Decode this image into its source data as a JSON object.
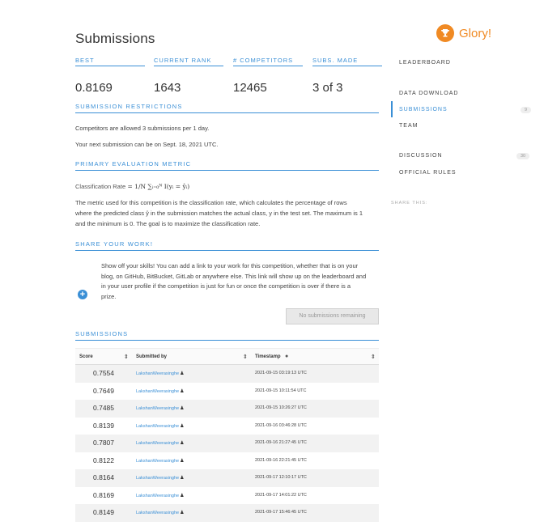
{
  "page": {
    "title": "Submissions"
  },
  "stats": [
    {
      "label": "BEST",
      "value": "0.8169"
    },
    {
      "label": "CURRENT RANK",
      "value": "1643"
    },
    {
      "label": "# COMPETITORS",
      "value": "12465"
    },
    {
      "label": "SUBS. MADE",
      "value": "3 of 3"
    }
  ],
  "restrictions": {
    "heading": "SUBMISSION RESTRICTIONS",
    "line1": "Competitors are allowed 3 submissions per 1 day.",
    "line2": "Your next submission can be on Sept. 18, 2021 UTC."
  },
  "metric": {
    "heading": "PRIMARY EVALUATION METRIC",
    "formula_label": "Classification Rate",
    "formula": "= 1/N ∑ᵢ₌₀ᴺ I(yᵢ = ŷᵢ)",
    "description_1": "The metric used for this competition is the classification rate, which calculates the percentage of rows",
    "description_2": "where the predicted class ŷ in the submission matches the actual class, y in the test set. The maximum is 1",
    "description_3": "and the minimum is 0. The goal is to maximize the classification rate."
  },
  "share": {
    "heading": "SHARE YOUR WORK!",
    "icon": "plus-circle-icon",
    "text_1": "Show off your skills! You can add a link to your work for this competition, whether that is on your",
    "text_2": "blog, on GitHub, BitBucket, GitLab or anywhere else. This link will show up on the leaderboard and",
    "text_3": "in your user profile if the competition is just for fun or once the competition is over if there is a",
    "text_4": "prize.",
    "button_label": "No submissions remaining"
  },
  "submissions": {
    "heading": "SUBMISSIONS",
    "columns": {
      "score": "Score",
      "submitted_by": "Submitted by",
      "timestamp": "Timestamp"
    },
    "rows": [
      {
        "score": "0.7554",
        "user": "LakshanWeerasinghe",
        "timestamp": "2021-09-15 03:19:13 UTC"
      },
      {
        "score": "0.7649",
        "user": "LakshanWeerasinghe",
        "timestamp": "2021-09-15 10:11:54 UTC"
      },
      {
        "score": "0.7485",
        "user": "LakshanWeerasinghe",
        "timestamp": "2021-09-15 10:26:27 UTC"
      },
      {
        "score": "0.8139",
        "user": "LakshanWeerasinghe",
        "timestamp": "2021-09-16 03:46:28 UTC"
      },
      {
        "score": "0.7807",
        "user": "LakshanWeerasinghe",
        "timestamp": "2021-09-16 21:27:45 UTC"
      },
      {
        "score": "0.8122",
        "user": "LakshanWeerasinghe",
        "timestamp": "2021-09-16 22:21:45 UTC"
      },
      {
        "score": "0.8164",
        "user": "LakshanWeerasinghe",
        "timestamp": "2021-09-17 12:10:17 UTC"
      },
      {
        "score": "0.8169",
        "user": "LakshanWeerasinghe",
        "timestamp": "2021-09-17 14:01:22 UTC"
      },
      {
        "score": "0.8149",
        "user": "LakshanWeerasinghe",
        "timestamp": "2021-09-17 15:46:45 UTC"
      }
    ]
  },
  "sidebar": {
    "glory_text": "Glory!",
    "glory_icon": "trophy-icon",
    "nav": [
      {
        "label": "LEADERBOARD"
      },
      {
        "label": "DATA DOWNLOAD"
      },
      {
        "label": "SUBMISSIONS",
        "badge": "9"
      },
      {
        "label": "TEAM"
      },
      {
        "label": "DISCUSSION",
        "badge": "30"
      },
      {
        "label": "OFFICIAL RULES"
      }
    ],
    "share_this": "SHARE THIS:"
  },
  "colors": {
    "accent": "#3a8fd6",
    "glory": "#f08a24"
  }
}
